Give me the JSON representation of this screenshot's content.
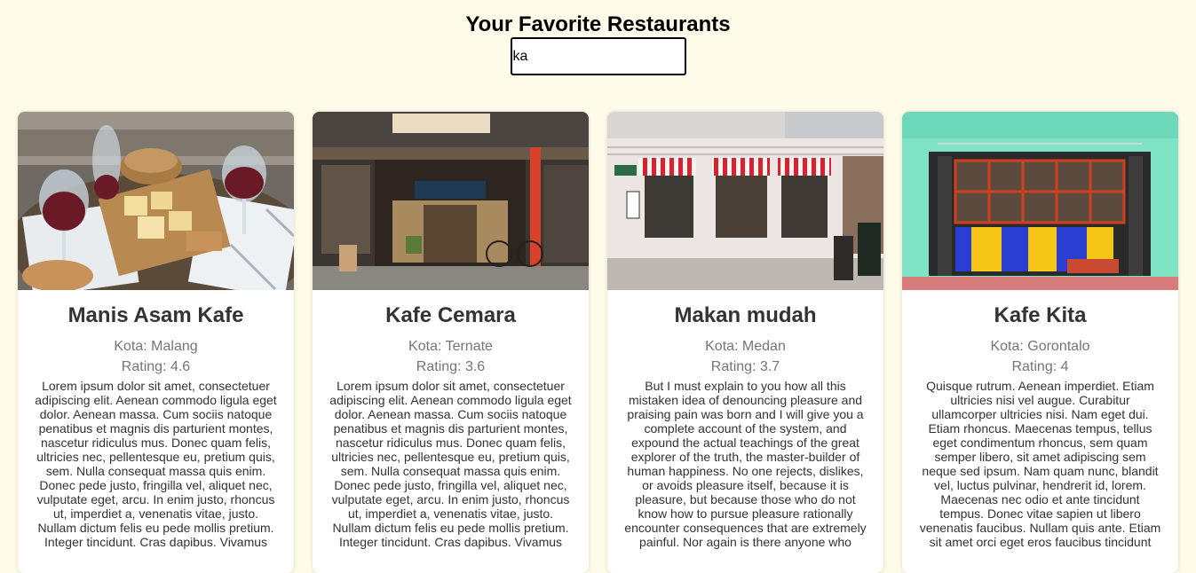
{
  "header": {
    "title": "Your Favorite Restaurants",
    "search_value": "ka"
  },
  "restaurants": [
    {
      "name": "Manis Asam Kafe",
      "city": "Kota: Malang",
      "rating": "Rating: 4.6",
      "description": "Lorem ipsum dolor sit amet, consectetuer adipiscing elit. Aenean commodo ligula eget dolor. Aenean massa. Cum sociis natoque penatibus et magnis dis parturient montes, nascetur ridiculus mus. Donec quam felis, ultricies nec, pellentesque eu, pretium quis, sem. Nulla consequat massa quis enim. Donec pede justo, fringilla vel, aliquet nec, vulputate eget, arcu. In enim justo, rhoncus ut, imperdiet a, venenatis vitae, justo. Nullam dictum felis eu pede mollis pretium. Integer tincidunt. Cras dapibus. Vivamus"
    },
    {
      "name": "Kafe Cemara",
      "city": "Kota: Ternate",
      "rating": "Rating: 3.6",
      "description": "Lorem ipsum dolor sit amet, consectetuer adipiscing elit. Aenean commodo ligula eget dolor. Aenean massa. Cum sociis natoque penatibus et magnis dis parturient montes, nascetur ridiculus mus. Donec quam felis, ultricies nec, pellentesque eu, pretium quis, sem. Nulla consequat massa quis enim. Donec pede justo, fringilla vel, aliquet nec, vulputate eget, arcu. In enim justo, rhoncus ut, imperdiet a, venenatis vitae, justo. Nullam dictum felis eu pede mollis pretium. Integer tincidunt. Cras dapibus. Vivamus"
    },
    {
      "name": "Makan mudah",
      "city": "Kota: Medan",
      "rating": "Rating: 3.7",
      "description": "But I must explain to you how all this mistaken idea of denouncing pleasure and praising pain was born and I will give you a complete account of the system, and expound the actual teachings of the great explorer of the truth, the master-builder of human happiness. No one rejects, dislikes, or avoids pleasure itself, because it is pleasure, but because those who do not know how to pursue pleasure rationally encounter consequences that are extremely painful. Nor again is there anyone who"
    },
    {
      "name": "Kafe Kita",
      "city": "Kota: Gorontalo",
      "rating": "Rating: 4",
      "description": "Quisque rutrum. Aenean imperdiet. Etiam ultricies nisi vel augue. Curabitur ullamcorper ultricies nisi. Nam eget dui. Etiam rhoncus. Maecenas tempus, tellus eget condimentum rhoncus, sem quam semper libero, sit amet adipiscing sem neque sed ipsum. Nam quam nunc, blandit vel, luctus pulvinar, hendrerit id, lorem. Maecenas nec odio et ante tincidunt tempus. Donec vitae sapien ut libero venenatis faucibus. Nullam quis ante. Etiam sit amet orci eget eros faucibus tincidunt"
    }
  ]
}
